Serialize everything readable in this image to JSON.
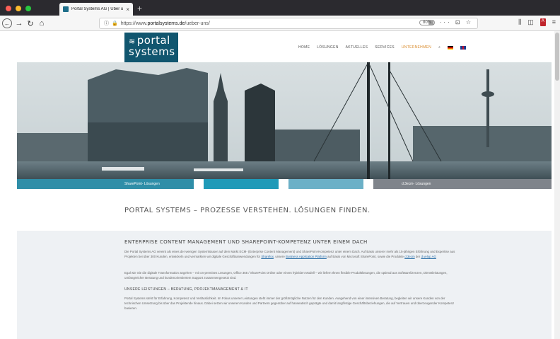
{
  "browser": {
    "tab_title": "Portal Systems AG | Über uns",
    "tab_close": "×",
    "new_tab": "+",
    "url_prefix": "https://www.",
    "url_domain": "portalsystems.de",
    "url_path": "/ueber-uns/",
    "zoom": "80%",
    "icons": [
      "back-icon",
      "forward-icon",
      "reload-icon",
      "home-icon",
      "info-icon",
      "lock-icon",
      "reader-icon",
      "more-icon",
      "pocket-icon",
      "star-icon",
      "library-icon",
      "sidebar-icon",
      "pdf-icon",
      "menu-icon"
    ]
  },
  "site": {
    "logo_line1": "portal",
    "logo_line2": "systems",
    "nav": [
      "HOME",
      "LÖSUNGEN",
      "AKTUELLES",
      "SERVICES",
      "UNTERNEHMEN"
    ],
    "active_nav": "UNTERNEHMEN",
    "accent": "#d98b2b",
    "brand": "#11566f"
  },
  "categories": [
    {
      "label": "SharePoint- Lösungen",
      "color": "#2f8ea8"
    },
    {
      "label": "",
      "color": "#1f9ab8"
    },
    {
      "label": "",
      "color": "#6bb0c7"
    },
    {
      "label": "d.3ecm- Lösungen",
      "color": "#7f848b"
    }
  ],
  "headline": "PORTAL SYSTEMS – PROZESSE VERSTEHEN. LÖSUNGEN FINDEN.",
  "section": {
    "title": "ENTERPRISE CONTENT MANAGEMENT UND SHAREPOINT-KOMPETENZ UNTER EINEM DACH",
    "p1": "Die Portal Systems AG vereint als eines der wenigen Systemhäuser auf dem Markt ECM- (Enterprise Content Management) und SharePoint-Kompetenz unter einem Dach. Auf Basis unserer mehr als 15-jährigen Erfahrung und Expertise aus Projekten bei über 300 Kunden, entwickeln und vermarkten wir digitale Geschäftsanwendungen für",
    "p1_link1": "Sharefox",
    "p1_mid": ", unsere",
    "p1_link2": "Business Application Platform",
    "p1_mid2": "auf Basis von Microsoft SharePoint, sowie die Produkte",
    "p1_link3": "d.3ecm",
    "p1_and": "der",
    "p1_link4": "d.velop AG",
    "p2": "Egal wie Sie die digitale Transformation angehen – mit on-premises Lösungen, Office 365 / SharePoint Online oder einem hybriden Modell – wir liefern Ihnen flexible Produktlösungen, die optimal aus Softwarelizenzen, Dienstleistungen, umfangreicher Beratung und kundenorientiertem Support zusammengesetzt sind.",
    "h3": "UNSERE LEISTUNGEN – BERATUNG, PROJEKTMANAGEMENT & IT",
    "p3": "Portal Systems steht für Erfahrung, Kompetenz und Verlässlichkeit. Im Fokus unserer Leistungen steht immer der größtmögliche Nutzen für den Kunden. Ausgehend von einer intensiven Beratung, begleiten wir unsere Kunden von der technischen Umsetzung bis über das Projektende hinaus. Dabei setzen wir unseren Kunden und Partnern gegenüber auf hanseatisch geprägte und damit langfristige Geschäftsbeziehungen, die auf Vertrauen und überzeugender Kompetenz basieren."
  }
}
